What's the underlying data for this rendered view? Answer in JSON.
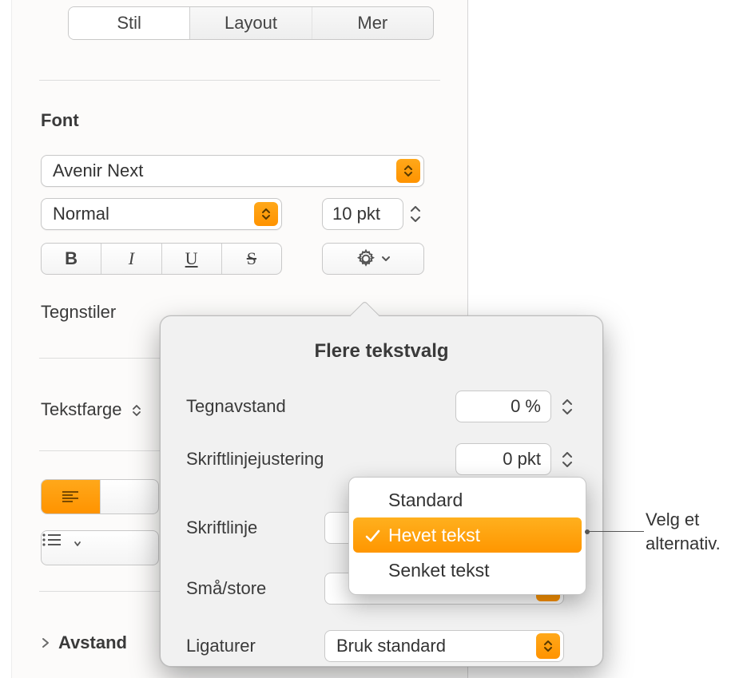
{
  "tabs": {
    "stil": "Stil",
    "layout": "Layout",
    "mer": "Mer"
  },
  "font": {
    "section": "Font",
    "family": "Avenir Next",
    "weight": "Normal",
    "size": "10 pkt",
    "bold": "B",
    "italic": "I",
    "underline": "U",
    "strike": "S"
  },
  "char_styles_label": "Tegnstiler",
  "text_color_label": "Tekstfarge",
  "spacing_label": "Avstand",
  "popover": {
    "title": "Flere tekstvalg",
    "char_spacing_label": "Tegnavstand",
    "char_spacing_value": "0 %",
    "baseline_label": "Skriftlinjejustering",
    "baseline_value": "0 pkt",
    "script_label": "Skriftlinje",
    "caps_label": "Små/store",
    "ligatures_label": "Ligaturer",
    "ligatures_value": "Bruk standard"
  },
  "menu": {
    "options": [
      "Standard",
      "Hevet tekst",
      "Senket tekst"
    ],
    "selected_index": 1
  },
  "callout": "Velg et alternativ."
}
